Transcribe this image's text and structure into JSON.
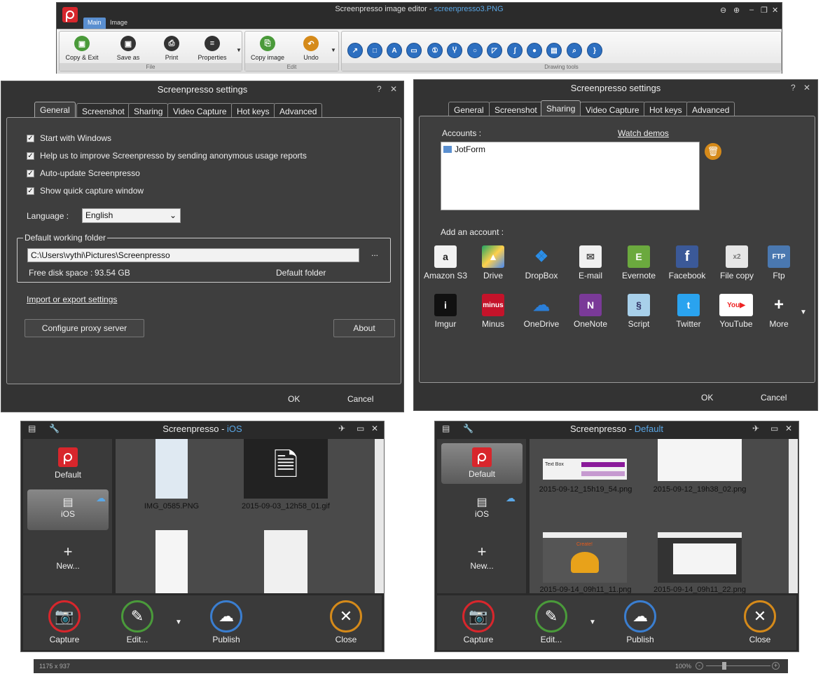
{
  "editor": {
    "title": "Screenpresso image editor",
    "sep": " - ",
    "file_name": "screenpresso3.PNG",
    "tabs": [
      "Main",
      "Image"
    ],
    "groups": {
      "file": "File",
      "edit": "Edit",
      "drawing": "Drawing tools"
    },
    "buttons": {
      "copy_exit": "Copy & Exit",
      "save_as": "Save as",
      "print": "Print",
      "properties": "Properties",
      "copy_image": "Copy image",
      "undo": "Undo"
    },
    "controls": {
      "back": "⊖",
      "forward": "⊕",
      "minimize": "–",
      "restore": "❐",
      "close": "✕"
    }
  },
  "settings_general": {
    "title": "Screenpresso settings",
    "help": "?",
    "close": "✕",
    "tabs": [
      "General",
      "Screenshot",
      "Sharing",
      "Video Capture",
      "Hot keys",
      "Advanced"
    ],
    "checks": [
      "Start with Windows",
      "Help us to improve Screenpresso by sending anonymous usage reports",
      "Auto-update Screenpresso",
      "Show quick capture window"
    ],
    "language_label": "Language :",
    "language_value": "English",
    "folder_group": "Default working folder",
    "folder_path": "C:\\Users\\vythi\\Pictures\\Screenpresso",
    "browse": "...",
    "disk_label": "Free disk space :",
    "disk_value": "93.54 GB",
    "default_folder": "Default folder",
    "import_export": "Import or export settings",
    "proxy": "Configure proxy server",
    "about": "About",
    "ok": "OK",
    "cancel": "Cancel"
  },
  "settings_sharing": {
    "title": "Screenpresso settings",
    "help": "?",
    "close": "✕",
    "tabs": [
      "General",
      "Screenshot",
      "Sharing",
      "Video Capture",
      "Hot keys",
      "Advanced"
    ],
    "accounts_label": "Accounts :",
    "watch_demos": "Watch demos",
    "account_item": "JotForm",
    "add_label": "Add an account :",
    "services_row1": [
      "Amazon S3",
      "Drive",
      "DropBox",
      "E-mail",
      "Evernote",
      "Facebook",
      "File copy",
      "Ftp"
    ],
    "services_row2": [
      "Imgur",
      "Minus",
      "OneDrive",
      "OneNote",
      "Script",
      "Twitter",
      "YouTube",
      "More"
    ],
    "ok": "OK",
    "cancel": "Cancel"
  },
  "sp_ios": {
    "title": "Screenpresso",
    "sep": " - ",
    "workspace": "iOS",
    "side": [
      "Default",
      "iOS",
      "New..."
    ],
    "thumbs": [
      "IMG_0585.PNG",
      "2015-09-03_12h58_01.gif"
    ],
    "actions": [
      "Capture",
      "Edit...",
      "Publish",
      "Close"
    ]
  },
  "sp_default": {
    "title": "Screenpresso",
    "sep": " - ",
    "workspace": "Default",
    "side": [
      "Default",
      "iOS",
      "New..."
    ],
    "thumbs": [
      "2015-09-12_15h19_54.png",
      "2015-09-12_19h38_02.png",
      "2015-09-14_09h11_11.png",
      "2015-09-14_09h11_22.png"
    ],
    "thumb_text": [
      "Text Box",
      "Create!"
    ],
    "actions": [
      "Capture",
      "Edit...",
      "Publish",
      "Close"
    ]
  },
  "status": {
    "size": "1175 x 937",
    "zoom": "100%"
  }
}
